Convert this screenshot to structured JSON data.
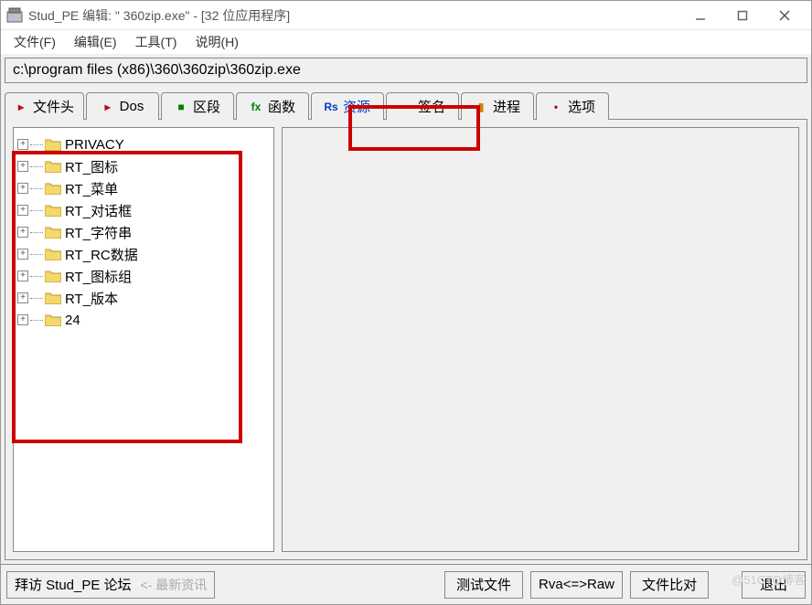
{
  "title": "Stud_PE 编辑: \"   360zip.exe\" - [32 位应用程序]",
  "menus": {
    "file": "文件(F)",
    "edit": "编辑(E)",
    "tools": "工具(T)",
    "help": "说明(H)"
  },
  "path": "c:\\program files (x86)\\360\\360zip\\360zip.exe",
  "tabs": [
    {
      "label": "文件头",
      "ico": "▸",
      "icoColor": "#c00020"
    },
    {
      "label": "Dos",
      "ico": "▸",
      "icoColor": "#c00020"
    },
    {
      "label": "区段",
      "ico": "■",
      "icoColor": "#008000"
    },
    {
      "label": "函数",
      "ico": "fx",
      "icoColor": "#008000"
    },
    {
      "label": "资源",
      "ico": "Rs",
      "icoColor": "#0040c0",
      "textColor": "#0040c0"
    },
    {
      "label": "签名",
      "ico": "",
      "icoColor": "#a0a000"
    },
    {
      "label": "进程",
      "ico": "▮",
      "icoColor": "#d08000"
    },
    {
      "label": "选项",
      "ico": "•",
      "icoColor": "#c00020"
    }
  ],
  "tree": [
    "PRIVACY",
    "RT_图标",
    "RT_菜单",
    "RT_对话框",
    "RT_字符串",
    "RT_RC数据",
    "RT_图标组",
    "RT_版本",
    "24"
  ],
  "bottom": {
    "forum": "拜访 Stud_PE 论坛",
    "hint": "<- 最新资讯",
    "test": "测试文件",
    "rva": "Rva<=>Raw",
    "compare": "文件比对",
    "exit": "退出"
  },
  "watermark": "@51CTO博客"
}
